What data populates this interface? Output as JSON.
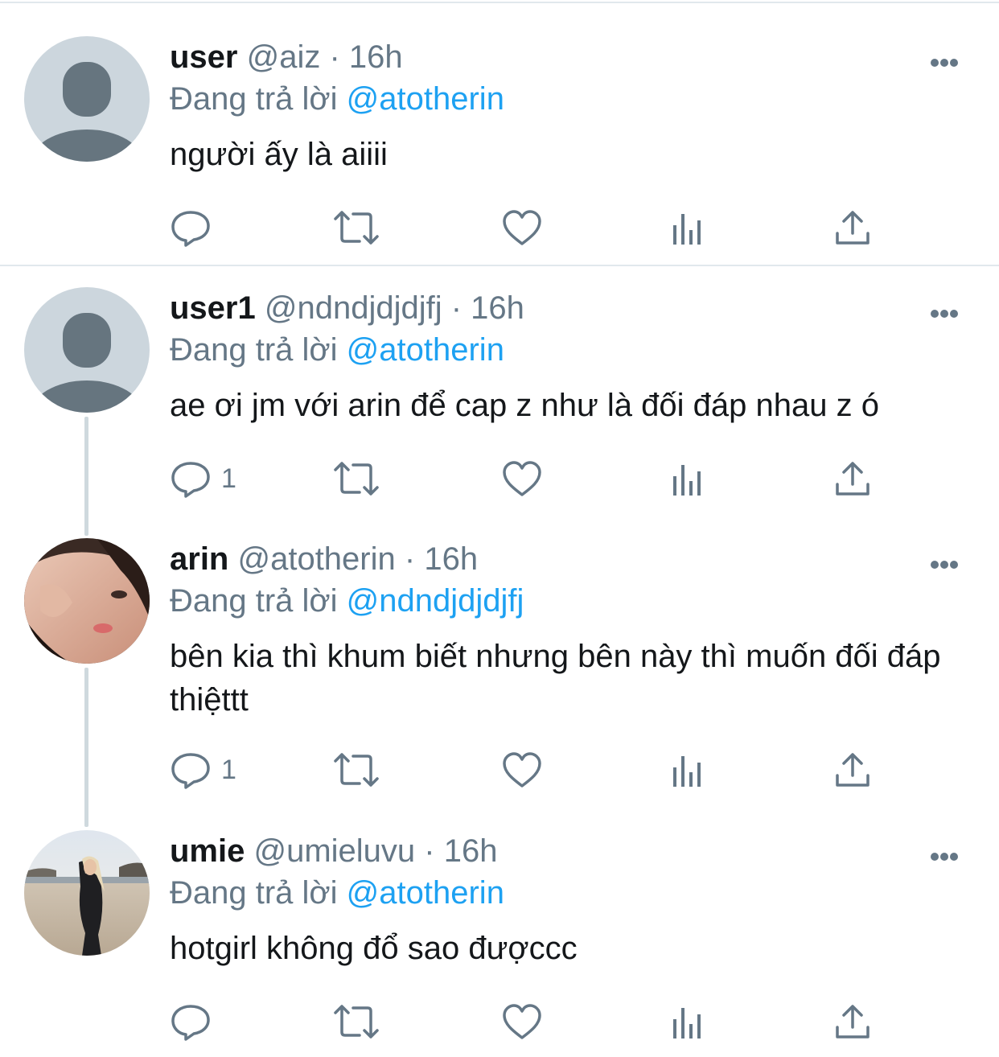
{
  "tweets": [
    {
      "name": "user",
      "handle": "@aiz",
      "time": "· 16h",
      "reply_prefix": "Đang trả lời",
      "reply_handle": "@atotherin",
      "text": "người ấy là aiiii",
      "reply_count": "",
      "avatar": "default-avatar-icon"
    },
    {
      "name": "user1",
      "handle": "@ndndjdjdjfj",
      "time": "· 16h",
      "reply_prefix": "Đang trả lời",
      "reply_handle": "@atotherin",
      "text": "ae ơi jm với arin để cap z như là đối đáp nhau z ó",
      "reply_count": "1",
      "avatar": "default-avatar-icon"
    },
    {
      "name": "arin",
      "handle": "@atotherin",
      "time": "· 16h",
      "reply_prefix": "Đang trả lời",
      "reply_handle": "@ndndjdjdjfj",
      "text": "bên kia thì khum biết nhưng bên này thì muốn đối đáp thiệttt",
      "reply_count": "1",
      "avatar": "profile-photo"
    },
    {
      "name": "umie",
      "handle": "@umieluvu",
      "time": "· 16h",
      "reply_prefix": "Đang trả lời",
      "reply_handle": "@atotherin",
      "text": "hotgirl không đổ sao đượccc",
      "reply_count": "",
      "avatar": "beach-photo"
    }
  ],
  "icons": {
    "reply": "reply-icon",
    "retweet": "retweet-icon",
    "like": "like-icon",
    "stats": "stats-icon",
    "share": "share-icon",
    "more": "more-icon"
  },
  "colors": {
    "link": "#1da1f2",
    "secondary_text": "#657786",
    "icon": "#657786",
    "divider": "#e1e8ed"
  }
}
